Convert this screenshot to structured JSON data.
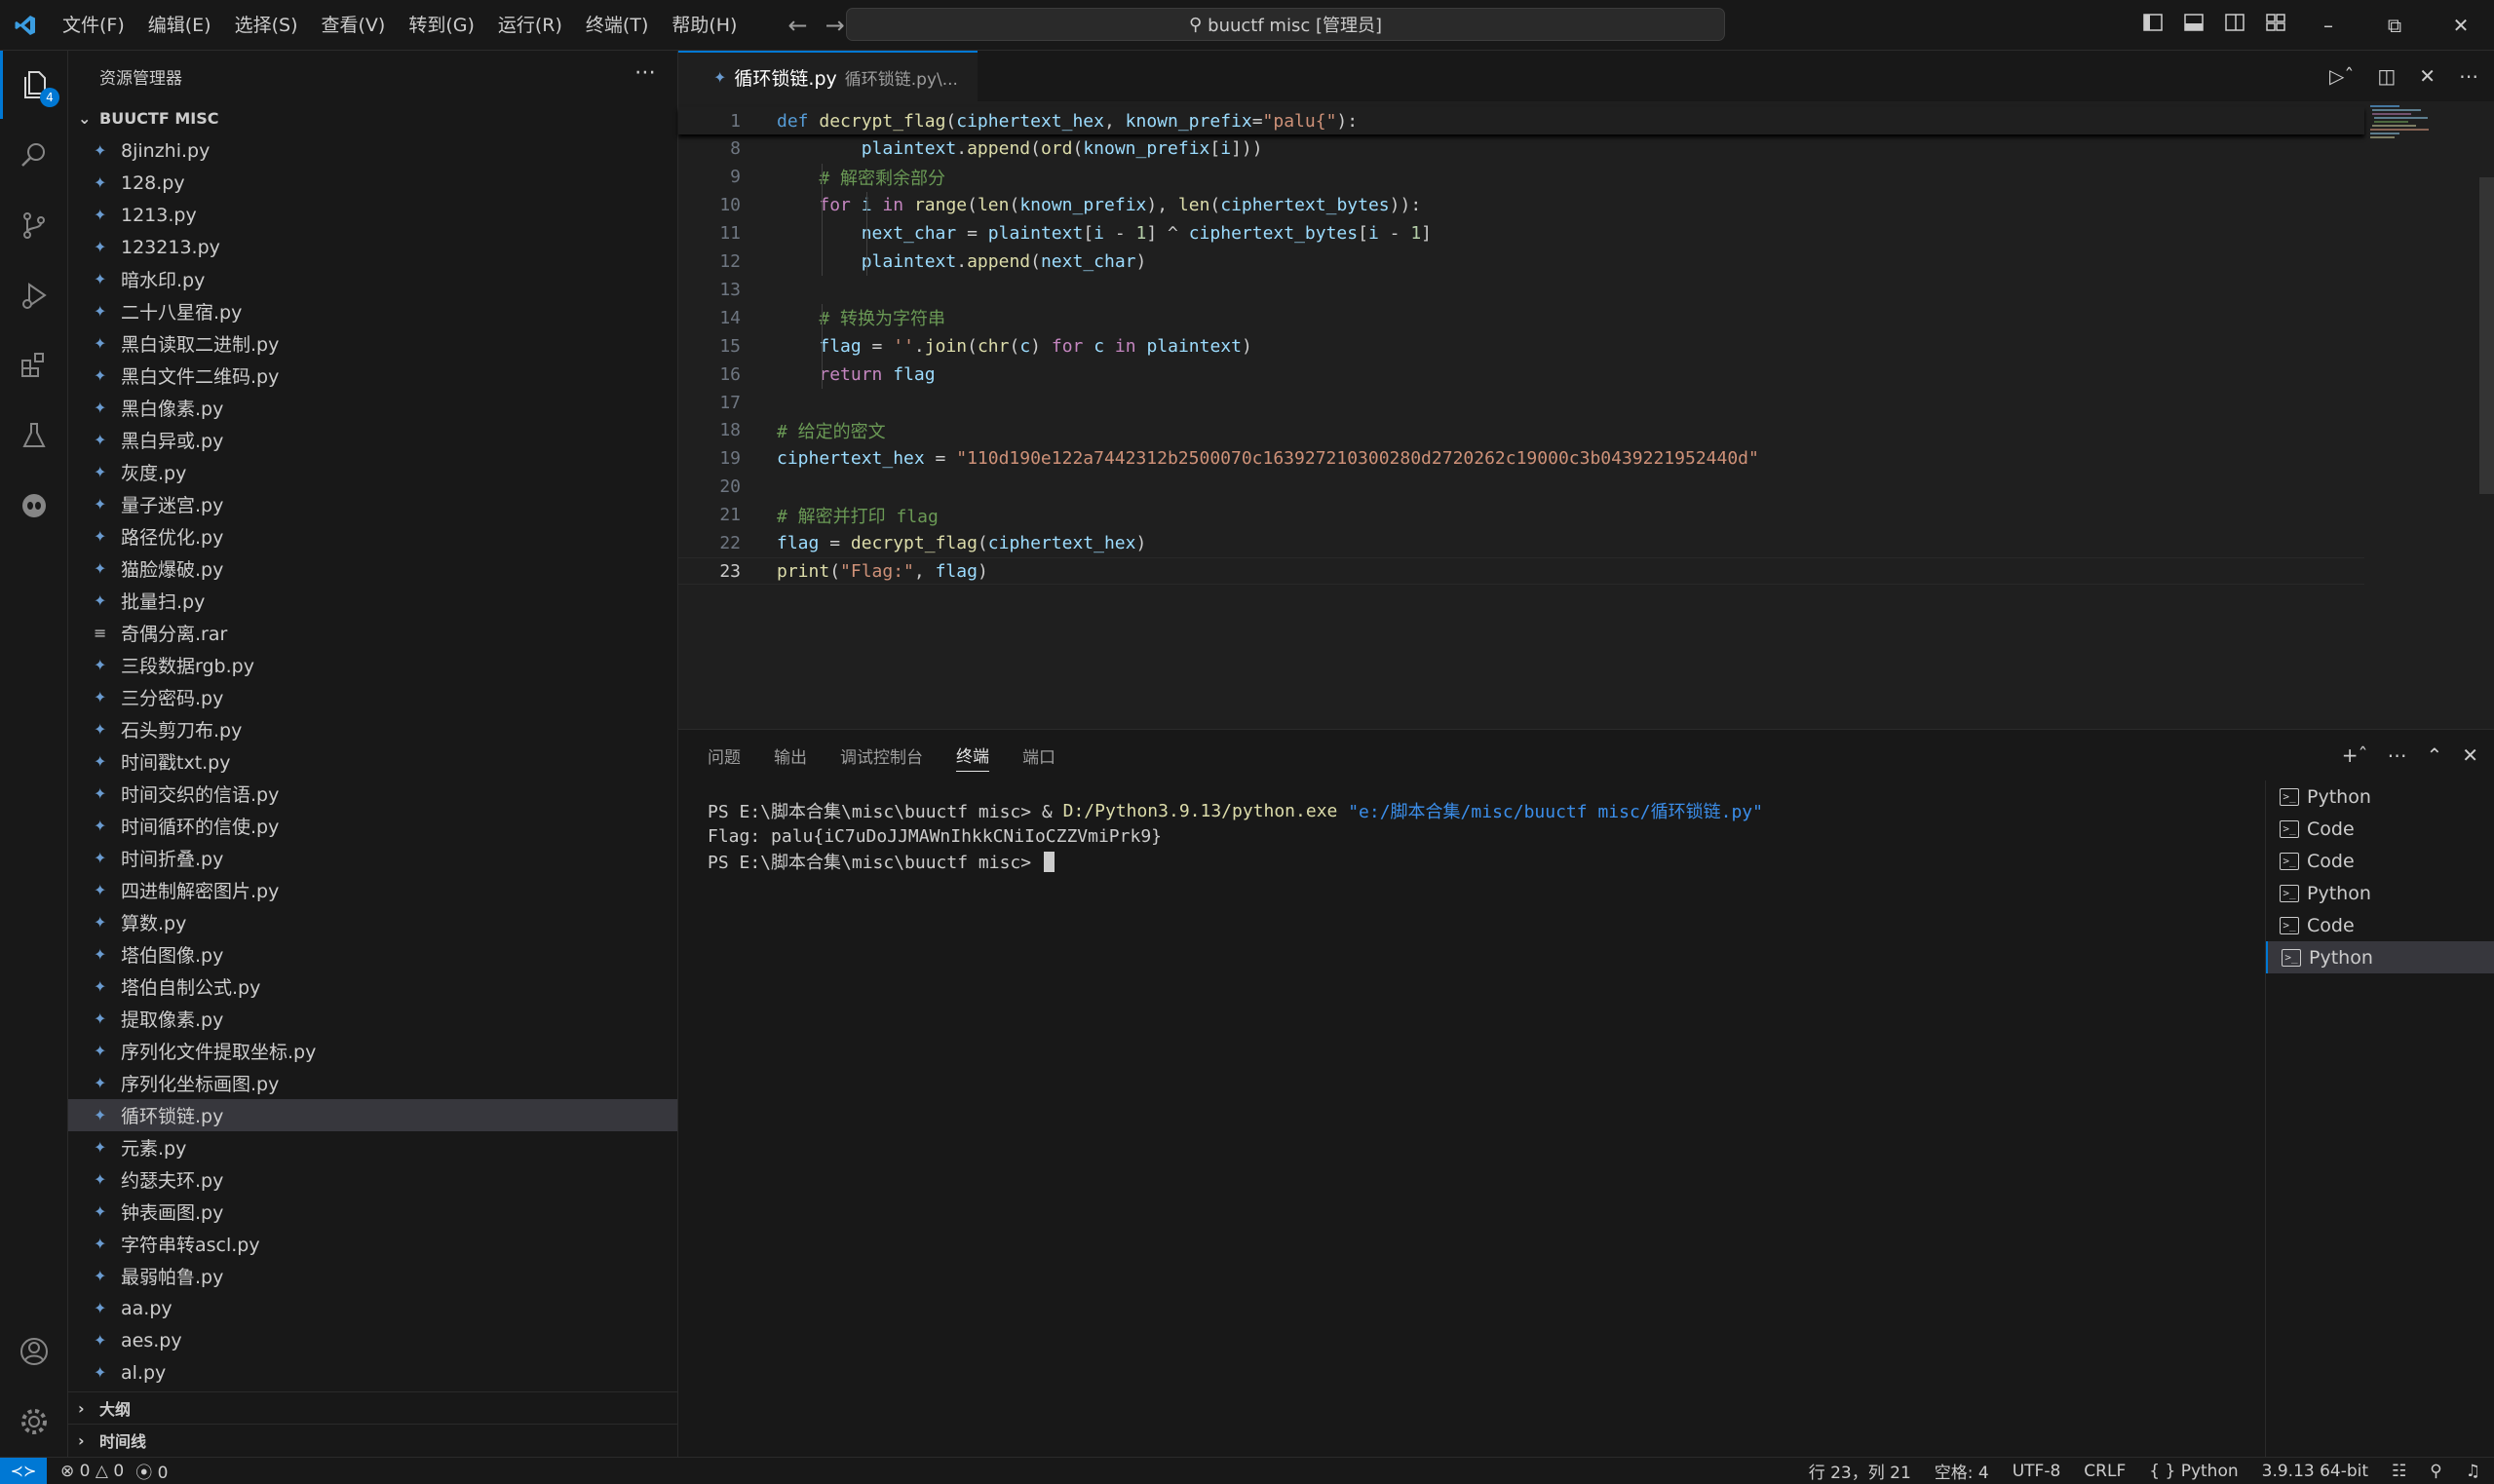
{
  "titlebar": {
    "menus": [
      "文件(F)",
      "编辑(E)",
      "选择(S)",
      "查看(V)",
      "转到(G)",
      "运行(R)",
      "终端(T)",
      "帮助(H)"
    ],
    "command_center": "buuctf misc [管理员]"
  },
  "activity": {
    "explorer_badge": "4"
  },
  "sidebar": {
    "title": "资源管理器",
    "folder": "BUUCTF MISC",
    "files": [
      "8jinzhi.py",
      "128.py",
      "1213.py",
      "123213.py",
      "暗水印.py",
      "二十八星宿.py",
      "黑白读取二进制.py",
      "黑白文件二维码.py",
      "黑白像素.py",
      "黑白异或.py",
      "灰度.py",
      "量子迷宫.py",
      "路径优化.py",
      "猫脸爆破.py",
      "批量扫.py",
      "奇偶分离.rar",
      "三段数据rgb.py",
      "三分密码.py",
      "石头剪刀布.py",
      "时间戳txt.py",
      "时间交织的信语.py",
      "时间循环的信使.py",
      "时间折叠.py",
      "四进制解密图片.py",
      "算数.py",
      "塔伯图像.py",
      "塔伯自制公式.py",
      "提取像素.py",
      "序列化文件提取坐标.py",
      "序列化坐标画图.py",
      "循环锁链.py",
      "元素.py",
      "约瑟夫环.py",
      "钟表画图.py",
      "字符串转ascl.py",
      "最弱帕鲁.py",
      "aa.py",
      "aes.py",
      "al.py"
    ],
    "selected_file": "循环锁链.py",
    "outline": "大纲",
    "timeline": "时间线"
  },
  "editor": {
    "tab_name": "循环锁链.py",
    "tab_desc": "循环锁链.py\\...",
    "lines": [
      {
        "n": "1",
        "code": "def decrypt_flag(ciphertext_hex, known_prefix=\"palu{\"):"
      },
      {
        "n": "8",
        "code": "        plaintext.append(ord(known_prefix[i]))"
      },
      {
        "n": "9",
        "code": "    # 解密剩余部分"
      },
      {
        "n": "10",
        "code": "    for i in range(len(known_prefix), len(ciphertext_bytes)):"
      },
      {
        "n": "11",
        "code": "        next_char = plaintext[i - 1] ^ ciphertext_bytes[i - 1]"
      },
      {
        "n": "12",
        "code": "        plaintext.append(next_char)"
      },
      {
        "n": "13",
        "code": ""
      },
      {
        "n": "14",
        "code": "    # 转换为字符串"
      },
      {
        "n": "15",
        "code": "    flag = ''.join(chr(c) for c in plaintext)"
      },
      {
        "n": "16",
        "code": "    return flag"
      },
      {
        "n": "17",
        "code": ""
      },
      {
        "n": "18",
        "code": "# 给定的密文"
      },
      {
        "n": "19",
        "code": "ciphertext_hex = \"110d190e122a7442312b2500070c163927210300280d2720262c19000c3b0439221952440d\""
      },
      {
        "n": "20",
        "code": ""
      },
      {
        "n": "21",
        "code": "# 解密并打印 flag"
      },
      {
        "n": "22",
        "code": "flag = decrypt_flag(ciphertext_hex)"
      },
      {
        "n": "23",
        "code": "print(\"Flag:\", flag)"
      }
    ]
  },
  "panel": {
    "tabs": [
      "问题",
      "输出",
      "调试控制台",
      "终端",
      "端口"
    ],
    "active_tab": "终端",
    "terminal": {
      "line1_prompt": "PS E:\\脚本合集\\misc\\buuctf misc> & ",
      "line1_cmd": "D:/Python3.9.13/python.exe",
      "line1_arg": " \"e:/脚本合集/misc/buuctf misc/循环锁链.py\"",
      "line2": "Flag: palu{iC7uDoJJMAWnIhkkCNiIoCZZVmiPrk9}",
      "line3": "PS E:\\脚本合集\\misc\\buuctf misc> "
    },
    "terminals": [
      "Python",
      "Code",
      "Code",
      "Python",
      "Code",
      "Python"
    ]
  },
  "statusbar": {
    "errors": "0",
    "warnings": "0",
    "ports": "0",
    "position": "行 23，列 21",
    "spaces": "空格: 4",
    "encoding": "UTF-8",
    "eol": "CRLF",
    "language": "Python",
    "interpreter": "3.9.13 64-bit"
  }
}
